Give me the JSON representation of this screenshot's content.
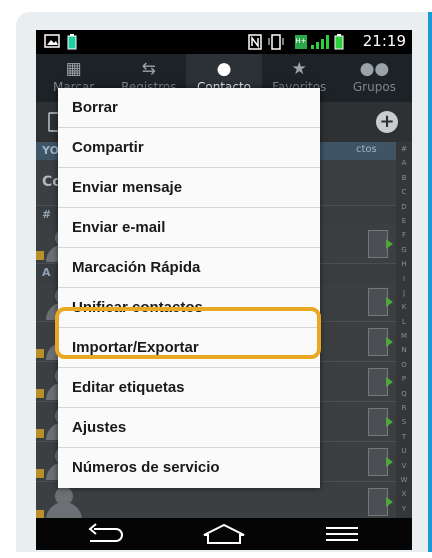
{
  "status_bar": {
    "time": "21:19",
    "icons": [
      "image-icon",
      "battery-saver-icon",
      "nfc-icon",
      "vibrate-icon",
      "data-icon",
      "signal-icon",
      "battery-icon"
    ]
  },
  "tabs": [
    {
      "label": "Marcar",
      "icon": "dialpad-icon",
      "active": false
    },
    {
      "label": "Registros",
      "icon": "call-log-icon",
      "active": false
    },
    {
      "label": "Contacto",
      "icon": "person-icon",
      "active": true
    },
    {
      "label": "Favoritos",
      "icon": "star-icon",
      "active": false
    },
    {
      "label": "Grupos",
      "icon": "groups-icon",
      "active": false
    }
  ],
  "background_list": {
    "section_me": "YO",
    "me_label": "Confi",
    "contacts_label": "ctos",
    "section_hash": "#",
    "section_a": "A",
    "index_letters": [
      "#",
      "A",
      "B",
      "C",
      "D",
      "E",
      "F",
      "G",
      "H",
      "I",
      "J",
      "K",
      "L",
      "M",
      "N",
      "O",
      "P",
      "Q",
      "R",
      "S",
      "T",
      "U",
      "V",
      "W",
      "X",
      "Y",
      "Z"
    ]
  },
  "menu": {
    "items": [
      "Borrar",
      "Compartir",
      "Enviar mensaje",
      "Enviar e-mail",
      "Marcación Rápida",
      "Unificar contactos",
      "Importar/Exportar",
      "Editar etiquetas",
      "Ajustes",
      "Números de servicio"
    ],
    "highlighted_item": "Importar/Exportar",
    "highlight_color": "#e8a823"
  },
  "nav_bar": {
    "buttons": [
      "back-icon",
      "home-icon",
      "menu-icon"
    ]
  }
}
